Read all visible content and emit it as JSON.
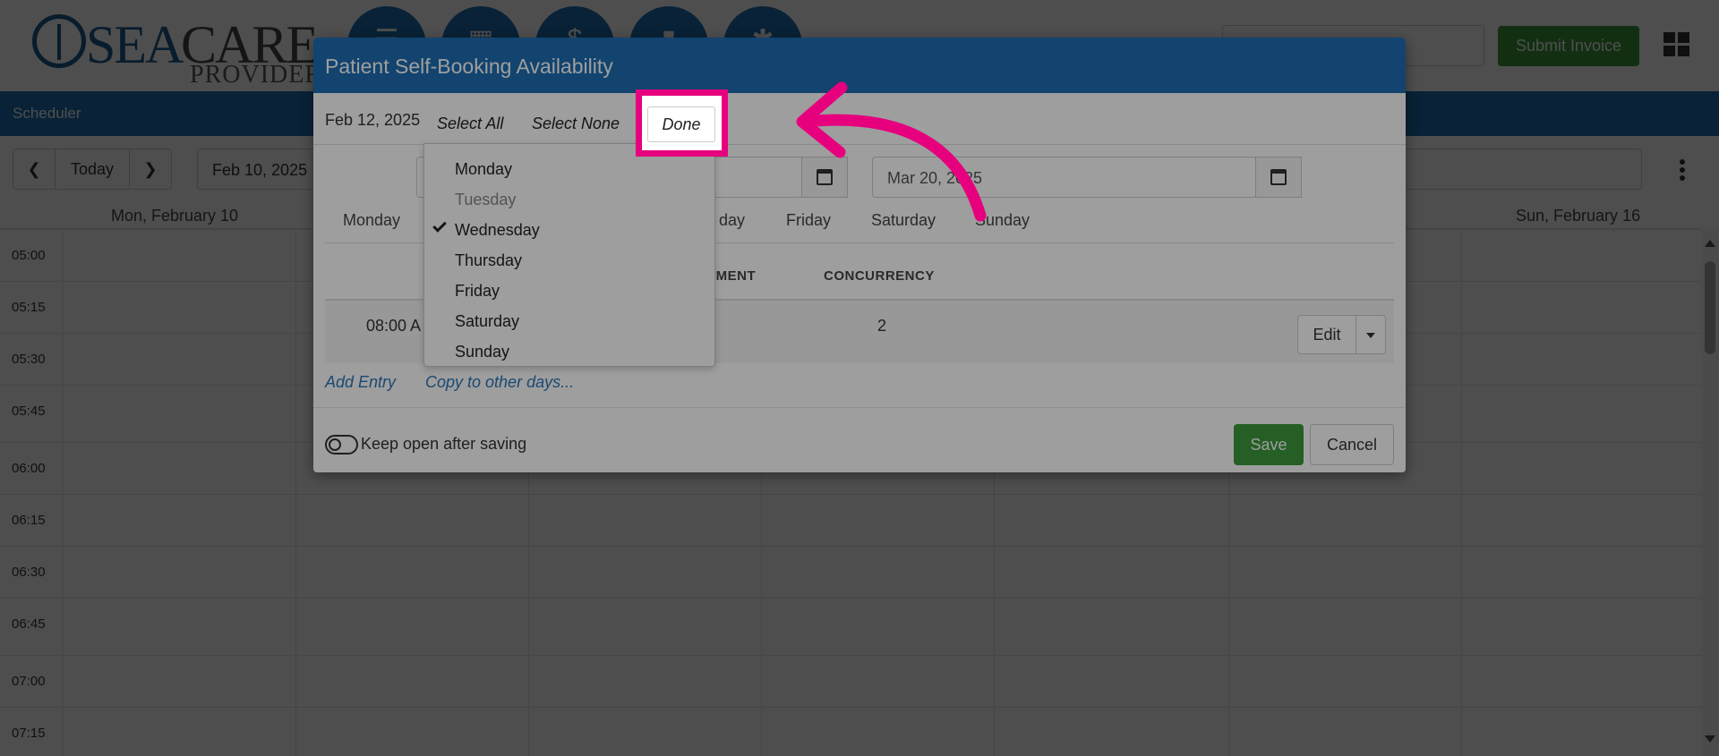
{
  "logo": {
    "part1": "SEA",
    "part2": "CARE",
    "part3": "PROVIDER"
  },
  "header": {
    "submit_invoice": "Submit Invoice"
  },
  "scheduler": {
    "label": "Scheduler"
  },
  "toolbar": {
    "today": "Today",
    "date": "Feb 10, 2025"
  },
  "calendar": {
    "day_headers": [
      "Mon, February 10",
      "Sun, February 16"
    ],
    "times": [
      "05:00",
      "05:15",
      "05:30",
      "05:45",
      "06:00",
      "06:15",
      "06:30",
      "06:45",
      "07:00",
      "07:15"
    ]
  },
  "modal": {
    "title": "Patient Self-Booking Availability",
    "sub_date": "Feb 12, 2025",
    "end_date": "Mar 20, 2025",
    "tabs": [
      "Monday",
      "day",
      "Friday",
      "Saturday",
      "Sunday"
    ],
    "col_appointment": "TMENT",
    "col_concurrency": "CONCURRENCY",
    "entry": {
      "time": "08:00 A",
      "concurrency": "2",
      "edit": "Edit"
    },
    "add_entry": "Add Entry",
    "copy_days": "Copy to other days...",
    "keep_open": "Keep open after saving",
    "save": "Save",
    "cancel": "Cancel"
  },
  "dropdown": {
    "select_all": "Select All",
    "select_none": "Select None",
    "done": "Done",
    "days": [
      "Monday",
      "Tuesday",
      "Wednesday",
      "Thursday",
      "Friday",
      "Saturday",
      "Sunday"
    ],
    "checked_day": "Wednesday",
    "muted_day": "Tuesday"
  },
  "colors": {
    "brand_blue": "#1e6fb3",
    "green": "#3c9a3c",
    "highlight": "#e6007e"
  }
}
